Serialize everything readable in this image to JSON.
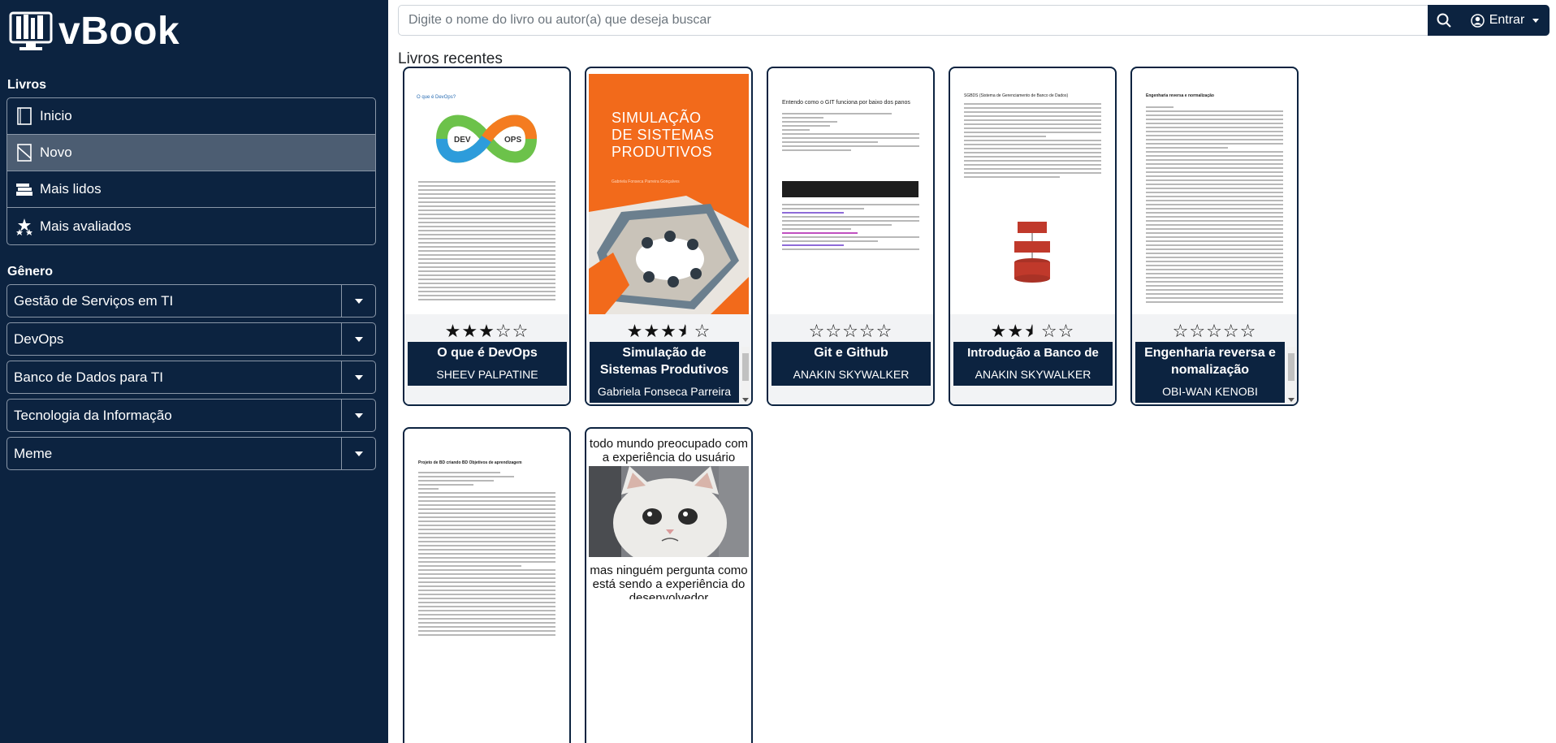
{
  "brand": {
    "name": "vBook"
  },
  "sidebar": {
    "books_heading": "Livros",
    "nav": [
      {
        "label": "Inicio",
        "icon": "book-icon",
        "active": false
      },
      {
        "label": "Novo",
        "icon": "new-book-icon",
        "active": true
      },
      {
        "label": "Mais lidos",
        "icon": "books-stack-icon",
        "active": false
      },
      {
        "label": "Mais avaliados",
        "icon": "stars-icon",
        "active": false
      }
    ],
    "genre_heading": "Gênero",
    "genres": [
      "Gestão de Serviços em TI",
      "DevOps",
      "Banco de Dados para TI",
      "Tecnologia da Informação",
      "Meme"
    ]
  },
  "search": {
    "placeholder": "Digite o nome do livro ou autor(a) que deseja buscar",
    "value": "",
    "login_label": "Entrar"
  },
  "main": {
    "heading": "Livros recentes",
    "books": [
      {
        "title": "O que é DevOps",
        "author": "SHEEV PALPATINE",
        "rating": 3
      },
      {
        "title": "Simulação de Sistemas Produtivos",
        "author": "Gabriela Fonseca Parreira",
        "rating": 3.5
      },
      {
        "title": "Git e Github",
        "author": "ANAKIN SKYWALKER",
        "rating": 0
      },
      {
        "title": "Introdução a Banco de Dados",
        "author": "ANAKIN SKYWALKER",
        "rating": 2.5
      },
      {
        "title": "Engenharia reversa e nomalização",
        "author": "OBI-WAN KENOBI",
        "rating": 0
      }
    ],
    "covers": {
      "devops_heading": "O que é DevOps?",
      "sim_title": "SIMULAÇÃO DE SISTEMAS PRODUTIVOS",
      "sim_author": "Gabriela Fonseca Parreira Gonçalves",
      "git_heading": "Entendo como o GIT funciona por baixo dos panos",
      "db_heading": "SGBDS (Sistema de Gerenciamento de Banco de Dados)",
      "eng_heading": "Engenharia reversa e normalização",
      "proj_heading": "Projeto de BD criando BD Objetivos de aprendizagem",
      "meme_top": "todo mundo preocupado com a experiência do usuário",
      "meme_bottom": "mas ninguém pergunta como está sendo a experiência do desenvolvedor"
    }
  }
}
